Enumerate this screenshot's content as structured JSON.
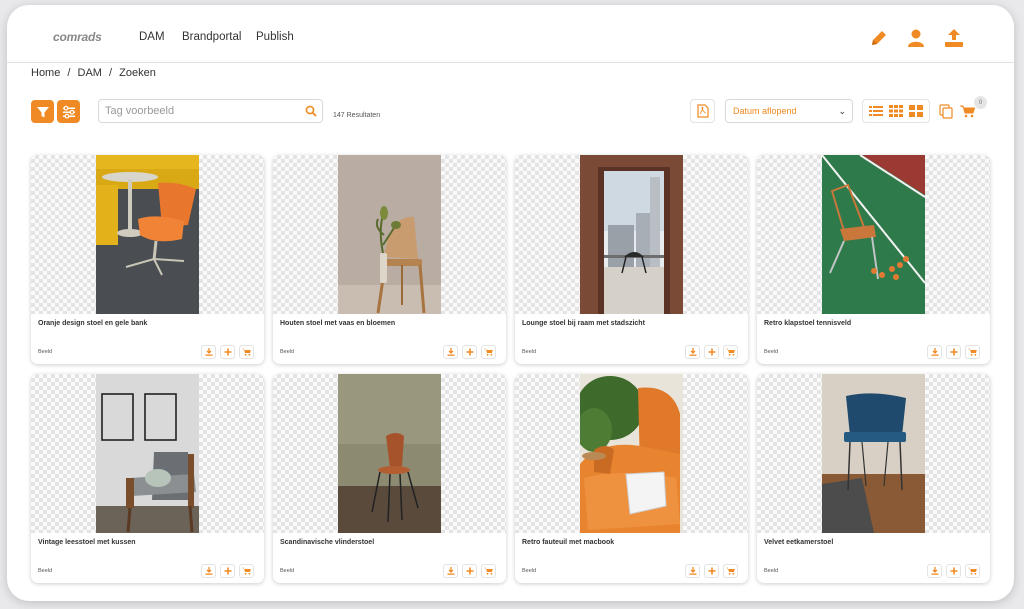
{
  "header": {
    "logo": "comrads",
    "nav": [
      "DAM",
      "Brandportal",
      "Publish"
    ]
  },
  "breadcrumb": [
    "Home",
    "/",
    "DAM",
    "/",
    "Zoeken"
  ],
  "search": {
    "placeholder": "Tag voorbeeld",
    "value": ""
  },
  "results": "147 Resultaten",
  "sort": {
    "selected": "Datum aflopend"
  },
  "cart_count": "0",
  "colors": {
    "accent": "#f08a24"
  },
  "cards": [
    {
      "title": "Oranje design stoel en gele bank",
      "type": "Beeld"
    },
    {
      "title": "Houten stoel met vaas en bloemen",
      "type": "Beeld"
    },
    {
      "title": "Lounge stoel bij raam met stadszicht",
      "type": "Beeld"
    },
    {
      "title": "Retro klapstoel tennisveld",
      "type": "Beeld"
    },
    {
      "title": "Vintage leesstoel met kussen",
      "type": "Beeld"
    },
    {
      "title": "Scandinavische vlinderstoel",
      "type": "Beeld"
    },
    {
      "title": "Retro fauteuil met macbook",
      "type": "Beeld"
    },
    {
      "title": "Velvet eetkamerstoel",
      "type": "Beeld"
    }
  ]
}
